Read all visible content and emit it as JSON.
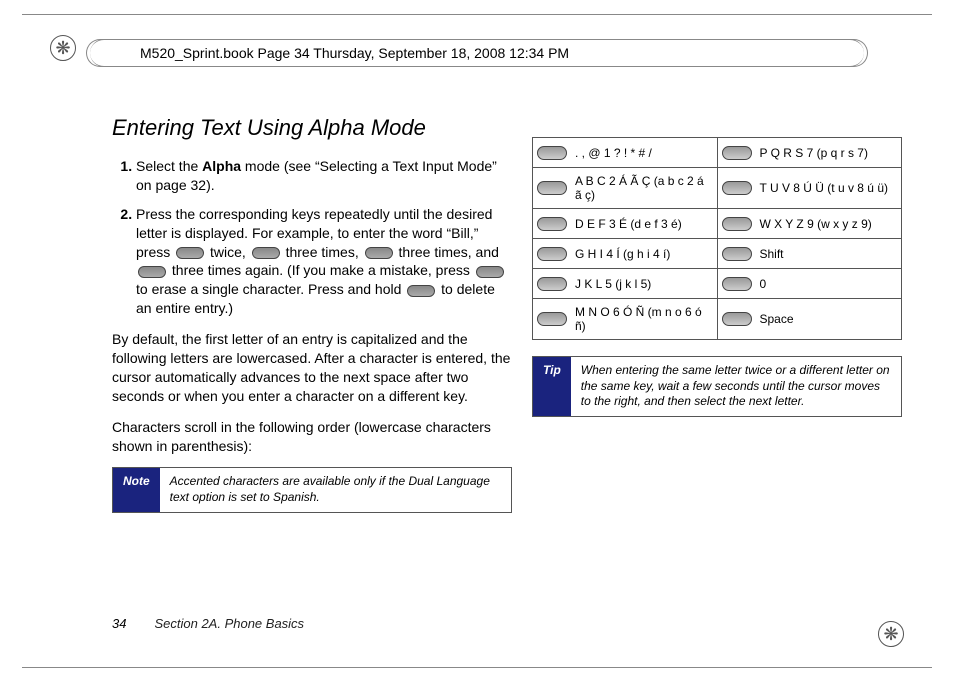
{
  "header": {
    "running_head": "M520_Sprint.book  Page 34  Thursday, September 18, 2008  12:34 PM"
  },
  "left": {
    "title": "Entering Text Using Alpha Mode",
    "step1_a": "Select the ",
    "step1_b_bold": "Alpha",
    "step1_c": " mode (see “Selecting a Text Input Mode” on page 32).",
    "step2_a": "Press the corresponding keys repeatedly until the desired letter is displayed. For example, to enter the word “Bill,” press ",
    "step2_b": " twice, ",
    "step2_c": " three times, ",
    "step2_d": " three times, and ",
    "step2_e": " three times again. (If you make a mistake, press ",
    "step2_f": " to erase a single character. Press and hold ",
    "step2_g": " to delete an entire entry.)",
    "para1": "By default, the first letter of an entry is capitalized and the following letters are lowercased. After a character is entered, the cursor automatically advances to the next space after two seconds or when you enter a character on a different key.",
    "para2": "Characters scroll in the following order (lowercase characters shown in parenthesis):",
    "note_tag": "Note",
    "note_msg": "Accented characters are available only if the Dual Language text option is set to Spanish."
  },
  "right": {
    "rows": [
      {
        "l": ". , @ 1 ? ! * # /",
        "r": "P Q R S 7 (p q r s 7)"
      },
      {
        "l": "A B C 2 Á Ã Ç (a b c 2 á ã ç)",
        "r": "T U V 8 Ú Ü (t u v 8 ú ü)"
      },
      {
        "l": "D E F 3 É (d e f 3 é)",
        "r": "W X Y Z 9 (w x y z 9)"
      },
      {
        "l": "G H I 4 Í (g h i 4 í)",
        "r": "Shift"
      },
      {
        "l": "J K L 5 (j k l 5)",
        "r": "0"
      },
      {
        "l": "M N O 6 Ó Ñ (m n o 6 ó ñ)",
        "r": "Space"
      }
    ],
    "tip_tag": "Tip",
    "tip_msg": "When entering the same letter twice or a different letter on the same key, wait a few seconds until the cursor moves to the right, and then select the next letter."
  },
  "footer": {
    "page_num": "34",
    "section": "Section 2A. Phone Basics"
  }
}
